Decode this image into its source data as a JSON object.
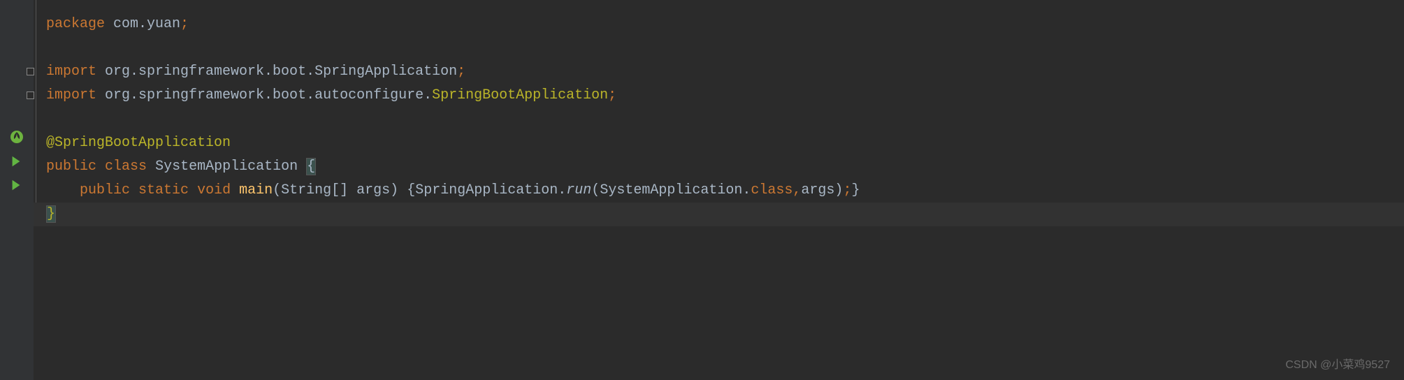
{
  "code": {
    "package_keyword": "package",
    "package_name": " com.yuan",
    "import_keyword": "import",
    "import1": " org.springframework.boot.SpringApplication",
    "import2_a": " org.springframework.boot.autoconfigure.",
    "import2_b": "SpringBootApplication",
    "annotation": "@SpringBootApplication",
    "public_keyword": "public",
    "class_keyword": "class",
    "class_name": "SystemApplication",
    "static_keyword": "static",
    "void_keyword": "void",
    "main_method": "main",
    "string_type": "String",
    "args_param": "[] args",
    "spring_app": "SpringApplication",
    "run_method": "run",
    "sys_app_class": "SystemApplication",
    "class_suffix": "class",
    "args_var": "args",
    "open_brace": "{",
    "close_brace": "}",
    "semicolon": ";",
    "dot": ".",
    "comma": ",",
    "open_paren": "(",
    "close_paren": ")",
    "space": " ",
    "indent4": "    "
  },
  "watermark": "CSDN @小菜鸡9527"
}
